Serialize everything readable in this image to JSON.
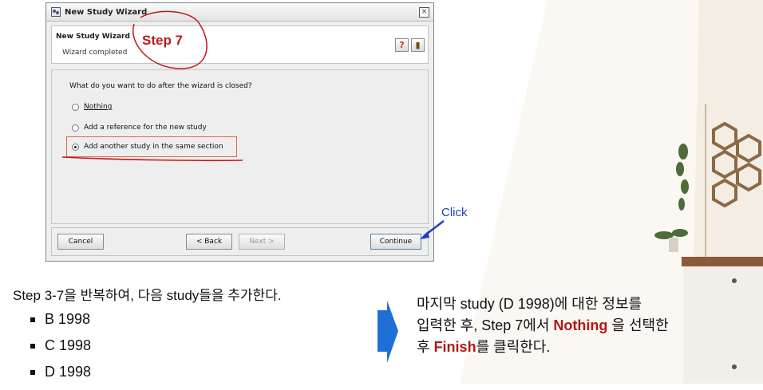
{
  "window": {
    "title": "New Study Wizard",
    "close_icon": "×"
  },
  "header": {
    "title": "New Study Wizard",
    "subtitle": "Wizard completed"
  },
  "content": {
    "question": "What do you want to do after the wizard is closed?",
    "options": [
      {
        "label": "Nothing",
        "selected": false
      },
      {
        "label": "Add a reference for the new study",
        "selected": false
      },
      {
        "label": "Add another study in the same section",
        "selected": true
      }
    ]
  },
  "buttons": {
    "cancel": "Cancel",
    "back": "< Back",
    "next": "Next >",
    "continue": "Continue"
  },
  "annotations": {
    "step": "Step 7",
    "click": "Click",
    "highlight_color": "#e0693a",
    "accent_red": "#c0181a",
    "accent_blue": "#1f3fbf"
  },
  "instructions": {
    "left": "Step 3-7을 반복하여, 다음 study들을 추가한다.",
    "items": [
      "B 1998",
      "C 1998",
      "D 1998"
    ],
    "right_line1": "마지막 study (D 1998)에 대한 정보를",
    "right_line2a": "입력한 후, Step 7에서 ",
    "right_nothing": "Nothing",
    "right_line2b": " 을 선택한",
    "right_line3a": "후 ",
    "right_finish": "Finish",
    "right_line3b": "를 클릭한다."
  }
}
